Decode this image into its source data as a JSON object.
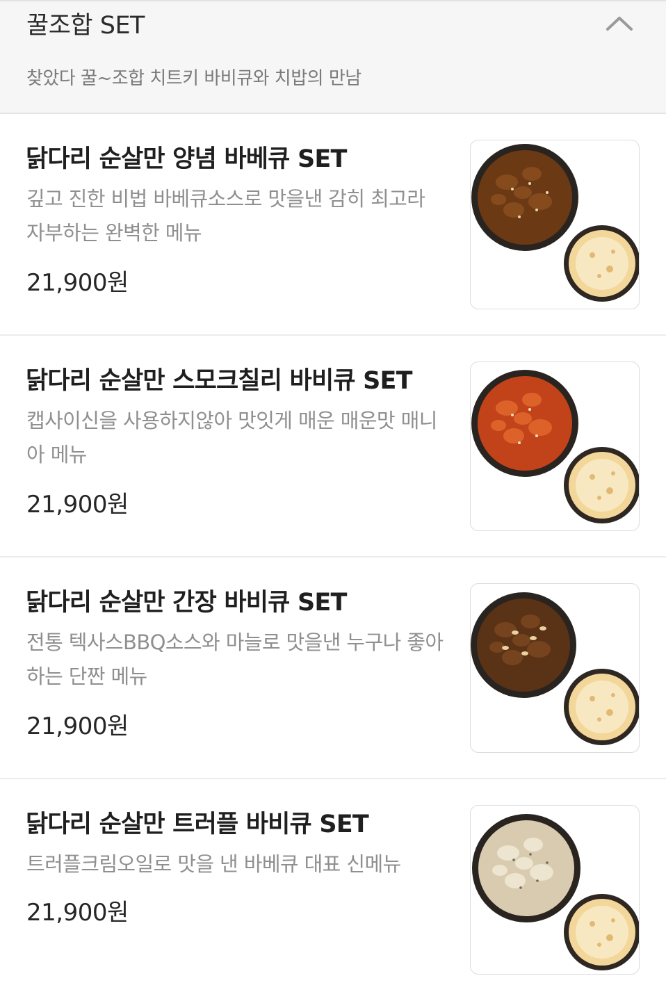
{
  "section": {
    "title": "꿀조합 SET",
    "subtitle": "찾았다 꿀~조합 치트키 바비큐와 치밥의 만남",
    "toggle_icon": "chevron-up-icon"
  },
  "menu_items": [
    {
      "name": "닭다리 순살만 양념 바베큐 SET",
      "description": "깊고 진한 비법 바베큐소스로 맛을낸 감히 최고라 자부하는 완벽한 메뉴",
      "price": "21,900원",
      "image": "bbq-chicken-with-cheese-rice-photo",
      "sauce_color": "#6b3a14"
    },
    {
      "name": "닭다리 순살만 스모크칠리 바비큐 SET",
      "description": "캡사이신을 사용하지않아 맛잇게 매운 매운맛 매니아 메뉴",
      "price": "21,900원",
      "image": "smoke-chili-chicken-with-cheese-rice-photo",
      "sauce_color": "#c2431a"
    },
    {
      "name": "닭다리 순살만 간장 바비큐 SET",
      "description": "전통 텍사스BBQ소스와 마늘로 맛을낸 누구나 좋아하는 단짠 메뉴",
      "price": "21,900원",
      "image": "soy-garlic-chicken-with-cheese-rice-photo",
      "sauce_color": "#5a3216"
    },
    {
      "name": "닭다리 순살만 트러플 바비큐 SET",
      "description": "트러플크림오일로 맛을 낸 바베큐 대표 신메뉴",
      "price": "21,900원",
      "image": "truffle-cream-chicken-with-cheese-rice-photo",
      "sauce_color": "#d9cbb0"
    }
  ]
}
